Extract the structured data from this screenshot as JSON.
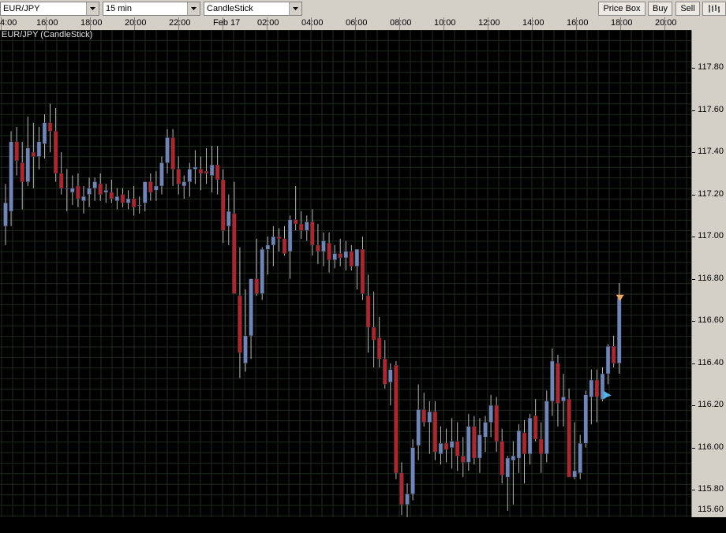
{
  "toolbar": {
    "symbol": "EUR/JPY",
    "interval": "15 min",
    "chart_style": "CandleStick",
    "price_box_label": "Price Box",
    "buy_label": "Buy",
    "sell_label": "Sell",
    "indicator_icon": "bar-chart-icon"
  },
  "chart": {
    "instrument_label": "EUR/JPY (CandleStick)",
    "time_labels": [
      "4:00",
      "16:00",
      "18:00",
      "20:00",
      "22:00",
      "Feb 17",
      "02:00",
      "04:00",
      "06:00",
      "08:00",
      "10:00",
      "12:00",
      "14:00",
      "16:00",
      "18:00",
      "20:00"
    ],
    "price_labels": [
      "117.80",
      "117.60",
      "117.40",
      "117.20",
      "117.00",
      "116.80",
      "116.60",
      "116.40",
      "116.20",
      "116.00",
      "115.80",
      "115.60"
    ],
    "colors": {
      "background": "#000000",
      "grid": "#1f2a1f",
      "up_candle": "#6f86b8",
      "down_candle": "#b0262a",
      "wick": "#b8b8b8",
      "marker_up": "#4fb3e8",
      "marker_down": "#f0a860"
    }
  },
  "chart_data": {
    "type": "candlestick",
    "ylim": [
      115.58,
      117.98
    ],
    "ohlc": [
      [
        117.05,
        117.25,
        116.96,
        117.16
      ],
      [
        117.12,
        117.5,
        117.05,
        117.45
      ],
      [
        117.45,
        117.52,
        117.29,
        117.36
      ],
      [
        117.35,
        117.45,
        117.13,
        117.26
      ],
      [
        117.26,
        117.57,
        117.24,
        117.42
      ],
      [
        117.4,
        117.54,
        117.23,
        117.38
      ],
      [
        117.38,
        117.52,
        117.32,
        117.45
      ],
      [
        117.44,
        117.58,
        117.37,
        117.54
      ],
      [
        117.54,
        117.63,
        117.4,
        117.5
      ],
      [
        117.5,
        117.61,
        117.26,
        117.3
      ],
      [
        117.3,
        117.4,
        117.2,
        117.23
      ],
      [
        117.23,
        117.32,
        117.12,
        117.23
      ],
      [
        117.21,
        117.29,
        117.15,
        117.23
      ],
      [
        117.24,
        117.3,
        117.14,
        117.18
      ],
      [
        117.17,
        117.24,
        117.11,
        117.19
      ],
      [
        117.2,
        117.28,
        117.14,
        117.23
      ],
      [
        117.23,
        117.28,
        117.17,
        117.26
      ],
      [
        117.25,
        117.3,
        117.17,
        117.2
      ],
      [
        117.21,
        117.25,
        117.16,
        117.22
      ],
      [
        117.21,
        117.27,
        117.16,
        117.18
      ],
      [
        117.17,
        117.23,
        117.13,
        117.19
      ],
      [
        117.2,
        117.23,
        117.14,
        117.16
      ],
      [
        117.16,
        117.22,
        117.13,
        117.18
      ],
      [
        117.18,
        117.24,
        117.1,
        117.14
      ],
      [
        117.15,
        117.19,
        117.11,
        117.15
      ],
      [
        117.16,
        117.24,
        117.12,
        117.26
      ],
      [
        117.26,
        117.3,
        117.17,
        117.21
      ],
      [
        117.22,
        117.31,
        117.17,
        117.24
      ],
      [
        117.24,
        117.38,
        117.2,
        117.35
      ],
      [
        117.35,
        117.51,
        117.3,
        117.47
      ],
      [
        117.47,
        117.51,
        117.24,
        117.32
      ],
      [
        117.32,
        117.38,
        117.2,
        117.25
      ],
      [
        117.24,
        117.29,
        117.18,
        117.26
      ],
      [
        117.26,
        117.35,
        117.19,
        117.32
      ],
      [
        117.32,
        117.41,
        117.25,
        117.33
      ],
      [
        117.32,
        117.38,
        117.22,
        117.3
      ],
      [
        117.31,
        117.42,
        117.25,
        117.3
      ],
      [
        117.29,
        117.43,
        117.21,
        117.34
      ],
      [
        117.34,
        117.43,
        117.2,
        117.27
      ],
      [
        117.27,
        117.32,
        116.97,
        117.03
      ],
      [
        117.05,
        117.2,
        116.96,
        117.12
      ],
      [
        117.11,
        117.26,
        116.82,
        116.73
      ],
      [
        116.72,
        116.95,
        116.33,
        116.45
      ],
      [
        116.4,
        116.75,
        116.36,
        116.53
      ],
      [
        116.53,
        116.78,
        116.42,
        116.8
      ],
      [
        116.8,
        116.99,
        116.72,
        116.73
      ],
      [
        116.73,
        116.95,
        116.7,
        116.94
      ],
      [
        116.94,
        117.0,
        116.82,
        116.96
      ],
      [
        116.96,
        117.05,
        116.86,
        117.0
      ],
      [
        117.0,
        117.04,
        116.93,
        116.99
      ],
      [
        116.99,
        117.05,
        116.91,
        116.92
      ],
      [
        116.93,
        117.1,
        116.8,
        117.08
      ],
      [
        117.08,
        117.24,
        117.03,
        117.06
      ],
      [
        117.06,
        117.12,
        116.99,
        117.03
      ],
      [
        117.03,
        117.1,
        116.98,
        117.07
      ],
      [
        117.07,
        117.13,
        116.91,
        116.96
      ],
      [
        116.96,
        117.06,
        116.87,
        116.93
      ],
      [
        116.93,
        117.02,
        116.86,
        116.98
      ],
      [
        116.97,
        117.02,
        116.83,
        116.89
      ],
      [
        116.89,
        116.96,
        116.85,
        116.92
      ],
      [
        116.92,
        116.99,
        116.86,
        116.9
      ],
      [
        116.9,
        116.98,
        116.84,
        116.93
      ],
      [
        116.93,
        116.96,
        116.84,
        116.86
      ],
      [
        116.86,
        116.94,
        116.75,
        116.94
      ],
      [
        116.94,
        117.0,
        116.7,
        116.73
      ],
      [
        116.72,
        116.82,
        116.45,
        116.57
      ],
      [
        116.57,
        116.74,
        116.38,
        116.51
      ],
      [
        116.52,
        116.62,
        116.38,
        116.42
      ],
      [
        116.42,
        116.51,
        116.28,
        116.3
      ],
      [
        116.31,
        116.4,
        116.2,
        116.37
      ],
      [
        116.39,
        116.41,
        115.85,
        115.88
      ],
      [
        115.88,
        115.93,
        115.68,
        115.73
      ],
      [
        115.73,
        115.83,
        115.63,
        115.78
      ],
      [
        115.78,
        116.04,
        115.75,
        116.0
      ],
      [
        116.01,
        116.3,
        115.94,
        116.18
      ],
      [
        116.18,
        116.26,
        116.1,
        116.12
      ],
      [
        116.12,
        116.22,
        115.97,
        116.17
      ],
      [
        116.17,
        116.22,
        115.94,
        115.98
      ],
      [
        115.97,
        116.1,
        115.92,
        116.02
      ],
      [
        116.02,
        116.09,
        115.93,
        115.99
      ],
      [
        116.0,
        116.14,
        115.9,
        116.03
      ],
      [
        116.03,
        116.12,
        115.89,
        115.96
      ],
      [
        115.96,
        116.05,
        115.86,
        115.93
      ],
      [
        115.93,
        116.16,
        115.89,
        116.1
      ],
      [
        116.1,
        116.15,
        115.92,
        115.95
      ],
      [
        115.95,
        116.14,
        115.88,
        116.06
      ],
      [
        116.05,
        116.15,
        115.98,
        116.12
      ],
      [
        116.12,
        116.25,
        116.05,
        116.2
      ],
      [
        116.2,
        116.24,
        115.98,
        116.03
      ],
      [
        116.03,
        116.09,
        115.83,
        115.87
      ],
      [
        115.86,
        115.96,
        115.7,
        115.95
      ],
      [
        115.94,
        116.03,
        115.73,
        115.96
      ],
      [
        115.95,
        116.11,
        115.88,
        116.08
      ],
      [
        116.07,
        116.13,
        115.83,
        115.97
      ],
      [
        115.97,
        116.16,
        115.92,
        116.14
      ],
      [
        116.15,
        116.23,
        116.03,
        116.04
      ],
      [
        116.04,
        116.12,
        115.88,
        115.97
      ],
      [
        115.97,
        116.27,
        115.93,
        116.22
      ],
      [
        116.22,
        116.47,
        116.15,
        116.41
      ],
      [
        116.4,
        116.44,
        116.1,
        116.21
      ],
      [
        116.22,
        116.35,
        116.1,
        116.24
      ],
      [
        116.23,
        116.28,
        115.9,
        115.86
      ],
      [
        115.86,
        116.12,
        115.85,
        115.89
      ],
      [
        115.88,
        116.06,
        115.85,
        116.02
      ],
      [
        116.02,
        116.27,
        116.0,
        116.25
      ],
      [
        116.24,
        116.37,
        116.11,
        116.32
      ],
      [
        116.32,
        116.37,
        116.12,
        116.24
      ],
      [
        116.23,
        116.38,
        116.22,
        116.35
      ],
      [
        116.35,
        116.49,
        116.3,
        116.48
      ],
      [
        116.48,
        116.53,
        116.38,
        116.4
      ],
      [
        116.4,
        116.78,
        116.35,
        116.71
      ]
    ]
  }
}
